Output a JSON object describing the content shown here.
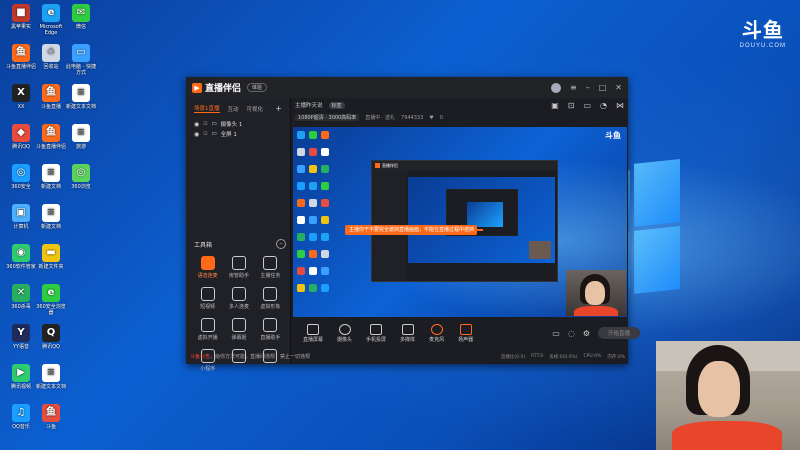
{
  "desktop_icons": [
    {
      "label": "黑苹果实",
      "color": "#c0392b",
      "glyph": "■"
    },
    {
      "label": "Microsoft Edge",
      "color": "#1da1f2",
      "glyph": "e"
    },
    {
      "label": "微信",
      "color": "#2ecc40",
      "glyph": "✉"
    },
    {
      "label": "斗鱼直播伴侣",
      "color": "#ff6a1a",
      "glyph": "鱼"
    },
    {
      "label": "回收站",
      "color": "#cfd8e3",
      "glyph": "♲"
    },
    {
      "label": "此电脑 - 快捷方式",
      "color": "#3aa0ff",
      "glyph": "▭"
    },
    {
      "label": "XX",
      "color": "#222",
      "glyph": "X"
    },
    {
      "label": "斗鱼直播",
      "color": "#ff6a1a",
      "glyph": "鱼"
    },
    {
      "label": "新建文本文档",
      "color": "#ffffff",
      "glyph": "≡"
    },
    {
      "label": "腾讯QQ",
      "color": "#e74c3c",
      "glyph": "◆"
    },
    {
      "label": "斗鱼直播伴侣",
      "color": "#ff6a1a",
      "glyph": "鱼"
    },
    {
      "label": "旅游",
      "color": "#ffffff",
      "glyph": "≡"
    },
    {
      "label": "360安全",
      "color": "#1a9eff",
      "glyph": "◎"
    },
    {
      "label": "新建文档",
      "color": "#ffffff",
      "glyph": "≡"
    },
    {
      "label": "360浏览",
      "color": "#5bd35b",
      "glyph": "◎"
    },
    {
      "label": "计算机",
      "color": "#4ab0ff",
      "glyph": "▣"
    },
    {
      "label": "新建文档",
      "color": "#ffffff",
      "glyph": "≡"
    },
    {
      "label": "360软件管家",
      "color": "#2ecc71",
      "glyph": "◉"
    },
    {
      "label": "新建文件夹",
      "color": "#f1c40f",
      "glyph": "▬"
    },
    {
      "label": "360杀毒",
      "color": "#27ae60",
      "glyph": "✕"
    },
    {
      "label": "360安全浏览器",
      "color": "#2ecc40",
      "glyph": "e"
    },
    {
      "label": "YY语音",
      "color": "#1f2b5c",
      "glyph": "Y"
    },
    {
      "label": "腾讯QQ",
      "color": "#222",
      "glyph": "Q"
    },
    {
      "label": "腾讯视频",
      "color": "#2ecc71",
      "glyph": "▶"
    },
    {
      "label": "新建文本文档",
      "color": "#ffffff",
      "glyph": "≡"
    },
    {
      "label": "QQ音乐",
      "color": "#1a9eff",
      "glyph": "♫"
    },
    {
      "label": "斗鱼",
      "color": "#e74c3c",
      "glyph": "鱼"
    }
  ],
  "watermark": {
    "main": "斗鱼",
    "sub": "DOUYU.COM"
  },
  "app": {
    "name": "直播伴侣",
    "version": "体验",
    "left_tabs": [
      "场景1直播",
      "互动",
      "可视化"
    ],
    "sources": [
      "摄像头 1",
      "全屏 1"
    ],
    "tools_title": "工具箱",
    "tools": [
      {
        "label": "语音连麦",
        "hot": true
      },
      {
        "label": "房管助手",
        "hot": false
      },
      {
        "label": "主播任务",
        "hot": false
      },
      {
        "label": "短视频",
        "hot": false
      },
      {
        "label": "多人连麦",
        "hot": false
      },
      {
        "label": "虚拟形象",
        "hot": false
      },
      {
        "label": "虚拟开播",
        "hot": false
      },
      {
        "label": "弹幕姬",
        "hot": false
      },
      {
        "label": "直播助手",
        "hot": false
      },
      {
        "label": "小程序",
        "hot": false
      },
      {
        "label": "",
        "hot": false
      },
      {
        "label": "",
        "hot": false
      }
    ],
    "bottom_note_prefix": "斗鱼公告",
    "bottom_note": "，给你方法可能，直播间违规，禁止一切违规",
    "room_title": "主播昨天说",
    "room_tag": "标签",
    "sub_quality": "1080P超清 · 3000高码率",
    "sub_info": "直播中 · 送礼",
    "sub_count": "7944333",
    "sub_likes": "0",
    "tooltip": "主播你干不要完全遮挡直播画面，不能在直播过程中遮挡",
    "preview_logo": "斗鱼",
    "controls": [
      "直播屏幕",
      "摄像头",
      "手机投屏",
      "多媒体",
      "麦克风",
      "扬声器"
    ],
    "live_button": "开始直播",
    "status": [
      "直播比(0.0)",
      "RTT:0",
      "丢帧:0(0.0%)",
      "CPU:0%",
      "内存:0%"
    ]
  }
}
